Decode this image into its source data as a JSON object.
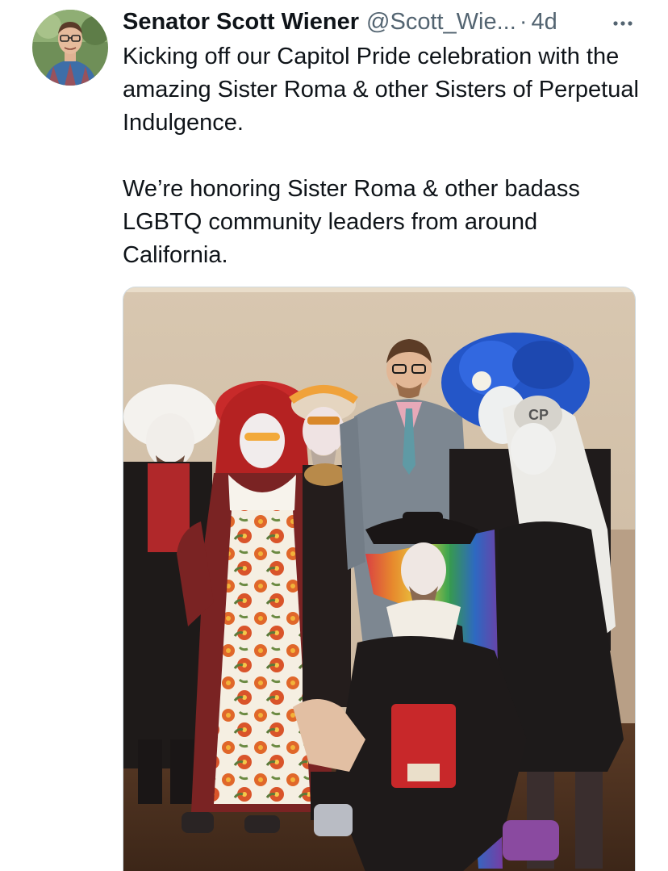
{
  "tweet": {
    "author": {
      "display_name": "Senator Scott Wiener",
      "handle": "@Scott_Wie...",
      "avatar_icon": "profile-avatar"
    },
    "separator": "·",
    "timestamp": "4d",
    "more_icon": "more-horizontal-icon",
    "text": "Kicking off our Capitol Pride celebration with the amazing Sister Roma & other Sisters of Perpetual Indulgence.\n\nWe’re honoring Sister Roma & other badass LGBTQ community leaders from around California.",
    "media": {
      "type": "photo",
      "badge_text": "CP"
    }
  },
  "colors": {
    "primary_text": "#0f1419",
    "secondary_text": "#536471",
    "border": "#cfd9de"
  }
}
